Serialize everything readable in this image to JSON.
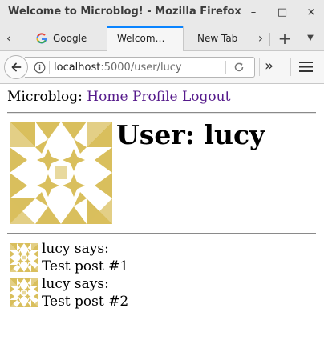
{
  "window": {
    "title": "Welcome to Microblog! - Mozilla Firefox",
    "buttons": {
      "minimize": "–",
      "maximize": "□",
      "close": "×"
    }
  },
  "tabs": [
    {
      "label": "Google",
      "active": false,
      "icon": "google-icon"
    },
    {
      "label": "Welcom…",
      "active": true
    },
    {
      "label": "New Tab",
      "active": false
    }
  ],
  "toolbar": {
    "url_host": "localhost",
    "url_path": ":5000/user/lucy",
    "overflow": "»",
    "new_tab": "+"
  },
  "colors": {
    "accent": "#0a84ff",
    "link": "#551a8b",
    "identicon": "#d9bf5d"
  },
  "nav": {
    "brand": "Microblog:",
    "links": [
      "Home",
      "Profile",
      "Logout"
    ]
  },
  "profile": {
    "heading": "User: lucy"
  },
  "posts": [
    {
      "author_line": "lucy says:",
      "body": "Test post #1"
    },
    {
      "author_line": "lucy says:",
      "body": "Test post #2"
    }
  ]
}
